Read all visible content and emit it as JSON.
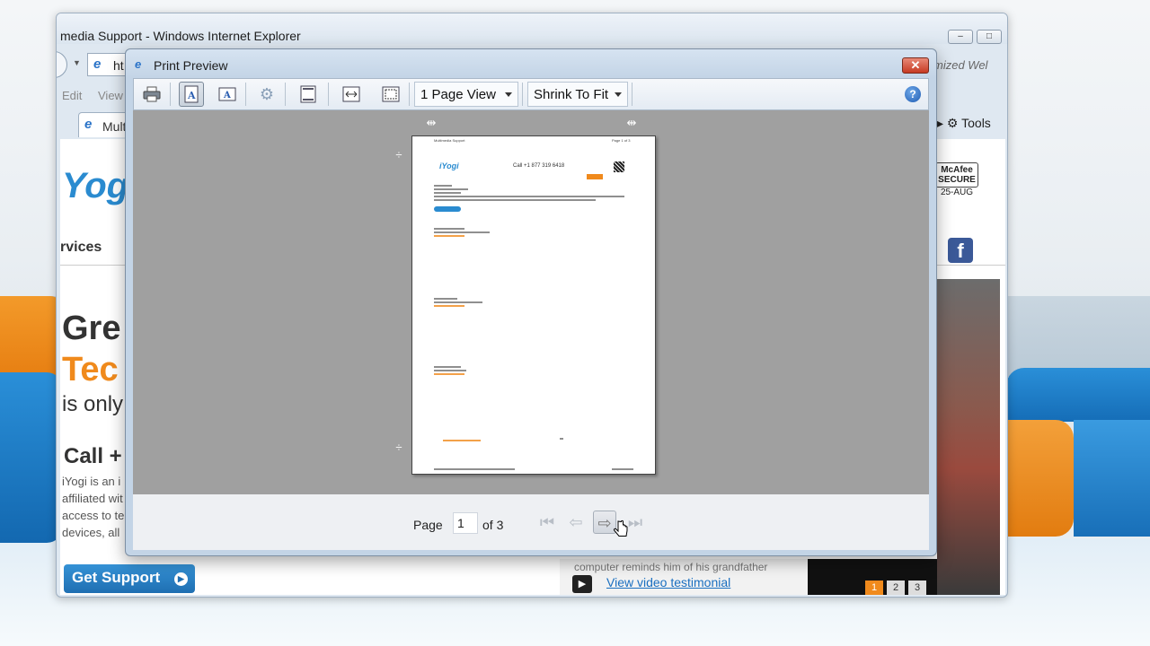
{
  "browser": {
    "title": "media Support - Windows Internet Explorer",
    "address_text": "ht",
    "search_text": "mized Wel",
    "menu": [
      "Edit",
      "View"
    ],
    "tab_label": "Mult",
    "tools_label": "Tools",
    "window_buttons": [
      "–",
      "□"
    ]
  },
  "background_page": {
    "logo": "Yogi",
    "logo_reg": "®",
    "nav_text": "rvices",
    "headline_1": "Gre",
    "headline_2": "Tec",
    "headline_3": "is only",
    "call_text": "Call +",
    "paragraph": [
      "iYogi is an i",
      "affiliated wit",
      "access to te",
      "devices, all"
    ],
    "get_support": "Get Support",
    "mcafee_lines": [
      "McAfee",
      "SECURE",
      "25-AUG"
    ],
    "testimonial_text": "computer reminds him of his grandfather",
    "testimonial_link": "View video testimonial",
    "pager": [
      "1",
      "2",
      "3"
    ]
  },
  "print_preview": {
    "title": "Print Preview",
    "close_label": "✕",
    "view_select": "1 Page View",
    "fit_select": "Shrink To Fit",
    "help_label": "?",
    "page_label": "Page",
    "page_value": "1",
    "of_text": "of 3",
    "preview_page": {
      "header_left": "Multimedia Support",
      "header_right": "Page 1 of 3",
      "logo": "iYogi",
      "phone": "Call +1 877 319 6418"
    }
  },
  "colors": {
    "accent_blue": "#2a8bd0",
    "accent_orange": "#f08a1c",
    "canvas_gray": "#a0a0a0"
  }
}
